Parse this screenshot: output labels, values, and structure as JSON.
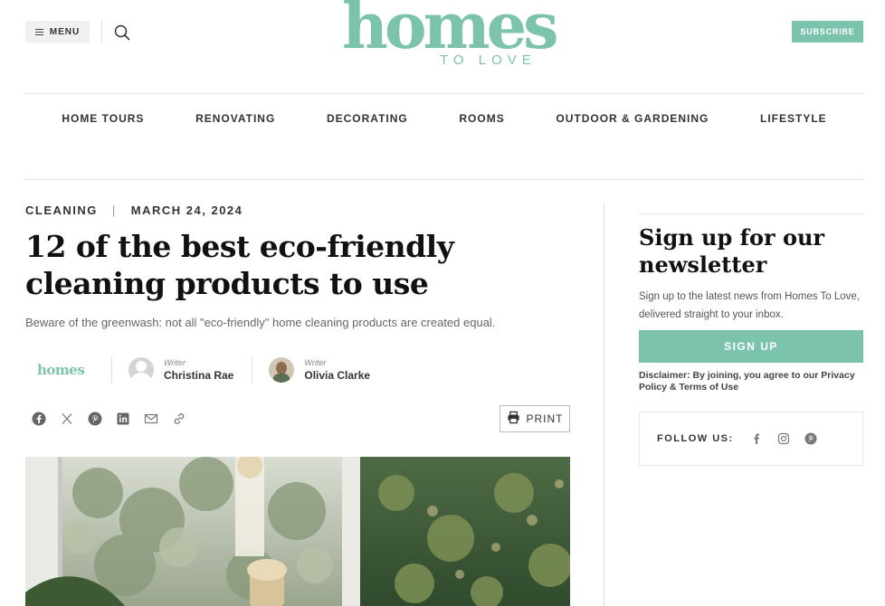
{
  "header": {
    "menu_label": "MENU",
    "logo_main": "homes",
    "logo_sub": "TO LOVE",
    "subscribe_label": "SUBSCRIBE"
  },
  "nav": {
    "items": [
      {
        "label": "HOME TOURS"
      },
      {
        "label": "RENOVATING"
      },
      {
        "label": "DECORATING"
      },
      {
        "label": "ROOMS"
      },
      {
        "label": "OUTDOOR & GARDENING"
      },
      {
        "label": "LIFESTYLE"
      }
    ]
  },
  "article": {
    "category": "CLEANING",
    "separator": "|",
    "date": "MARCH 24, 2024",
    "title": "12 of the best eco-friendly cleaning products to use",
    "standfirst": "Beware of the greenwash: not all \"eco-friendly\" home cleaning products are created equal.",
    "brand_logo": "homes",
    "authors": [
      {
        "role": "Writer",
        "name": "Christina Rae"
      },
      {
        "role": "Writer",
        "name": "Olivia Clarke"
      }
    ],
    "share_icons": [
      "facebook-icon",
      "x-icon",
      "pinterest-icon",
      "linkedin-icon",
      "email-icon",
      "link-icon"
    ],
    "print_label": "PRINT"
  },
  "sidebar": {
    "newsletter_title": "Sign up for our newsletter",
    "newsletter_text": "Sign up to the latest news from Homes To Love, delivered straight to your inbox.",
    "signup_label": "SIGN UP",
    "disclaimer": "Disclaimer: By joining, you agree to our Privacy Policy & Terms of Use",
    "follow_label": "FOLLOW US:",
    "follow_icons": [
      "facebook-icon",
      "instagram-icon",
      "pinterest-icon"
    ]
  },
  "colors": {
    "brand": "#7cc3ae",
    "text": "#1a1a1a",
    "muted": "#666666"
  }
}
